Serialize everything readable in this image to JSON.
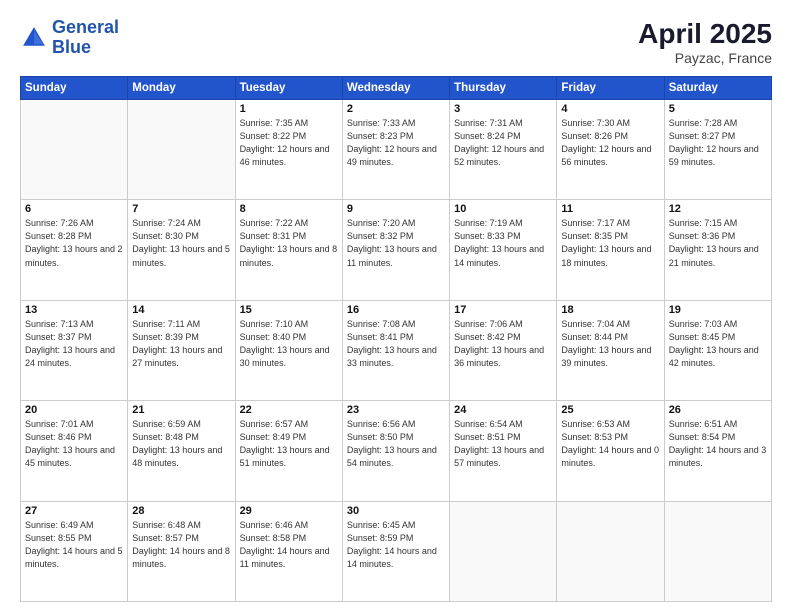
{
  "logo": {
    "line1": "General",
    "line2": "Blue"
  },
  "title": "April 2025",
  "location": "Payzac, France",
  "weekdays": [
    "Sunday",
    "Monday",
    "Tuesday",
    "Wednesday",
    "Thursday",
    "Friday",
    "Saturday"
  ],
  "weeks": [
    [
      {
        "day": "",
        "sunrise": "",
        "sunset": "",
        "daylight": ""
      },
      {
        "day": "",
        "sunrise": "",
        "sunset": "",
        "daylight": ""
      },
      {
        "day": "1",
        "sunrise": "Sunrise: 7:35 AM",
        "sunset": "Sunset: 8:22 PM",
        "daylight": "Daylight: 12 hours and 46 minutes."
      },
      {
        "day": "2",
        "sunrise": "Sunrise: 7:33 AM",
        "sunset": "Sunset: 8:23 PM",
        "daylight": "Daylight: 12 hours and 49 minutes."
      },
      {
        "day": "3",
        "sunrise": "Sunrise: 7:31 AM",
        "sunset": "Sunset: 8:24 PM",
        "daylight": "Daylight: 12 hours and 52 minutes."
      },
      {
        "day": "4",
        "sunrise": "Sunrise: 7:30 AM",
        "sunset": "Sunset: 8:26 PM",
        "daylight": "Daylight: 12 hours and 56 minutes."
      },
      {
        "day": "5",
        "sunrise": "Sunrise: 7:28 AM",
        "sunset": "Sunset: 8:27 PM",
        "daylight": "Daylight: 12 hours and 59 minutes."
      }
    ],
    [
      {
        "day": "6",
        "sunrise": "Sunrise: 7:26 AM",
        "sunset": "Sunset: 8:28 PM",
        "daylight": "Daylight: 13 hours and 2 minutes."
      },
      {
        "day": "7",
        "sunrise": "Sunrise: 7:24 AM",
        "sunset": "Sunset: 8:30 PM",
        "daylight": "Daylight: 13 hours and 5 minutes."
      },
      {
        "day": "8",
        "sunrise": "Sunrise: 7:22 AM",
        "sunset": "Sunset: 8:31 PM",
        "daylight": "Daylight: 13 hours and 8 minutes."
      },
      {
        "day": "9",
        "sunrise": "Sunrise: 7:20 AM",
        "sunset": "Sunset: 8:32 PM",
        "daylight": "Daylight: 13 hours and 11 minutes."
      },
      {
        "day": "10",
        "sunrise": "Sunrise: 7:19 AM",
        "sunset": "Sunset: 8:33 PM",
        "daylight": "Daylight: 13 hours and 14 minutes."
      },
      {
        "day": "11",
        "sunrise": "Sunrise: 7:17 AM",
        "sunset": "Sunset: 8:35 PM",
        "daylight": "Daylight: 13 hours and 18 minutes."
      },
      {
        "day": "12",
        "sunrise": "Sunrise: 7:15 AM",
        "sunset": "Sunset: 8:36 PM",
        "daylight": "Daylight: 13 hours and 21 minutes."
      }
    ],
    [
      {
        "day": "13",
        "sunrise": "Sunrise: 7:13 AM",
        "sunset": "Sunset: 8:37 PM",
        "daylight": "Daylight: 13 hours and 24 minutes."
      },
      {
        "day": "14",
        "sunrise": "Sunrise: 7:11 AM",
        "sunset": "Sunset: 8:39 PM",
        "daylight": "Daylight: 13 hours and 27 minutes."
      },
      {
        "day": "15",
        "sunrise": "Sunrise: 7:10 AM",
        "sunset": "Sunset: 8:40 PM",
        "daylight": "Daylight: 13 hours and 30 minutes."
      },
      {
        "day": "16",
        "sunrise": "Sunrise: 7:08 AM",
        "sunset": "Sunset: 8:41 PM",
        "daylight": "Daylight: 13 hours and 33 minutes."
      },
      {
        "day": "17",
        "sunrise": "Sunrise: 7:06 AM",
        "sunset": "Sunset: 8:42 PM",
        "daylight": "Daylight: 13 hours and 36 minutes."
      },
      {
        "day": "18",
        "sunrise": "Sunrise: 7:04 AM",
        "sunset": "Sunset: 8:44 PM",
        "daylight": "Daylight: 13 hours and 39 minutes."
      },
      {
        "day": "19",
        "sunrise": "Sunrise: 7:03 AM",
        "sunset": "Sunset: 8:45 PM",
        "daylight": "Daylight: 13 hours and 42 minutes."
      }
    ],
    [
      {
        "day": "20",
        "sunrise": "Sunrise: 7:01 AM",
        "sunset": "Sunset: 8:46 PM",
        "daylight": "Daylight: 13 hours and 45 minutes."
      },
      {
        "day": "21",
        "sunrise": "Sunrise: 6:59 AM",
        "sunset": "Sunset: 8:48 PM",
        "daylight": "Daylight: 13 hours and 48 minutes."
      },
      {
        "day": "22",
        "sunrise": "Sunrise: 6:57 AM",
        "sunset": "Sunset: 8:49 PM",
        "daylight": "Daylight: 13 hours and 51 minutes."
      },
      {
        "day": "23",
        "sunrise": "Sunrise: 6:56 AM",
        "sunset": "Sunset: 8:50 PM",
        "daylight": "Daylight: 13 hours and 54 minutes."
      },
      {
        "day": "24",
        "sunrise": "Sunrise: 6:54 AM",
        "sunset": "Sunset: 8:51 PM",
        "daylight": "Daylight: 13 hours and 57 minutes."
      },
      {
        "day": "25",
        "sunrise": "Sunrise: 6:53 AM",
        "sunset": "Sunset: 8:53 PM",
        "daylight": "Daylight: 14 hours and 0 minutes."
      },
      {
        "day": "26",
        "sunrise": "Sunrise: 6:51 AM",
        "sunset": "Sunset: 8:54 PM",
        "daylight": "Daylight: 14 hours and 3 minutes."
      }
    ],
    [
      {
        "day": "27",
        "sunrise": "Sunrise: 6:49 AM",
        "sunset": "Sunset: 8:55 PM",
        "daylight": "Daylight: 14 hours and 5 minutes."
      },
      {
        "day": "28",
        "sunrise": "Sunrise: 6:48 AM",
        "sunset": "Sunset: 8:57 PM",
        "daylight": "Daylight: 14 hours and 8 minutes."
      },
      {
        "day": "29",
        "sunrise": "Sunrise: 6:46 AM",
        "sunset": "Sunset: 8:58 PM",
        "daylight": "Daylight: 14 hours and 11 minutes."
      },
      {
        "day": "30",
        "sunrise": "Sunrise: 6:45 AM",
        "sunset": "Sunset: 8:59 PM",
        "daylight": "Daylight: 14 hours and 14 minutes."
      },
      {
        "day": "",
        "sunrise": "",
        "sunset": "",
        "daylight": ""
      },
      {
        "day": "",
        "sunrise": "",
        "sunset": "",
        "daylight": ""
      },
      {
        "day": "",
        "sunrise": "",
        "sunset": "",
        "daylight": ""
      }
    ]
  ]
}
